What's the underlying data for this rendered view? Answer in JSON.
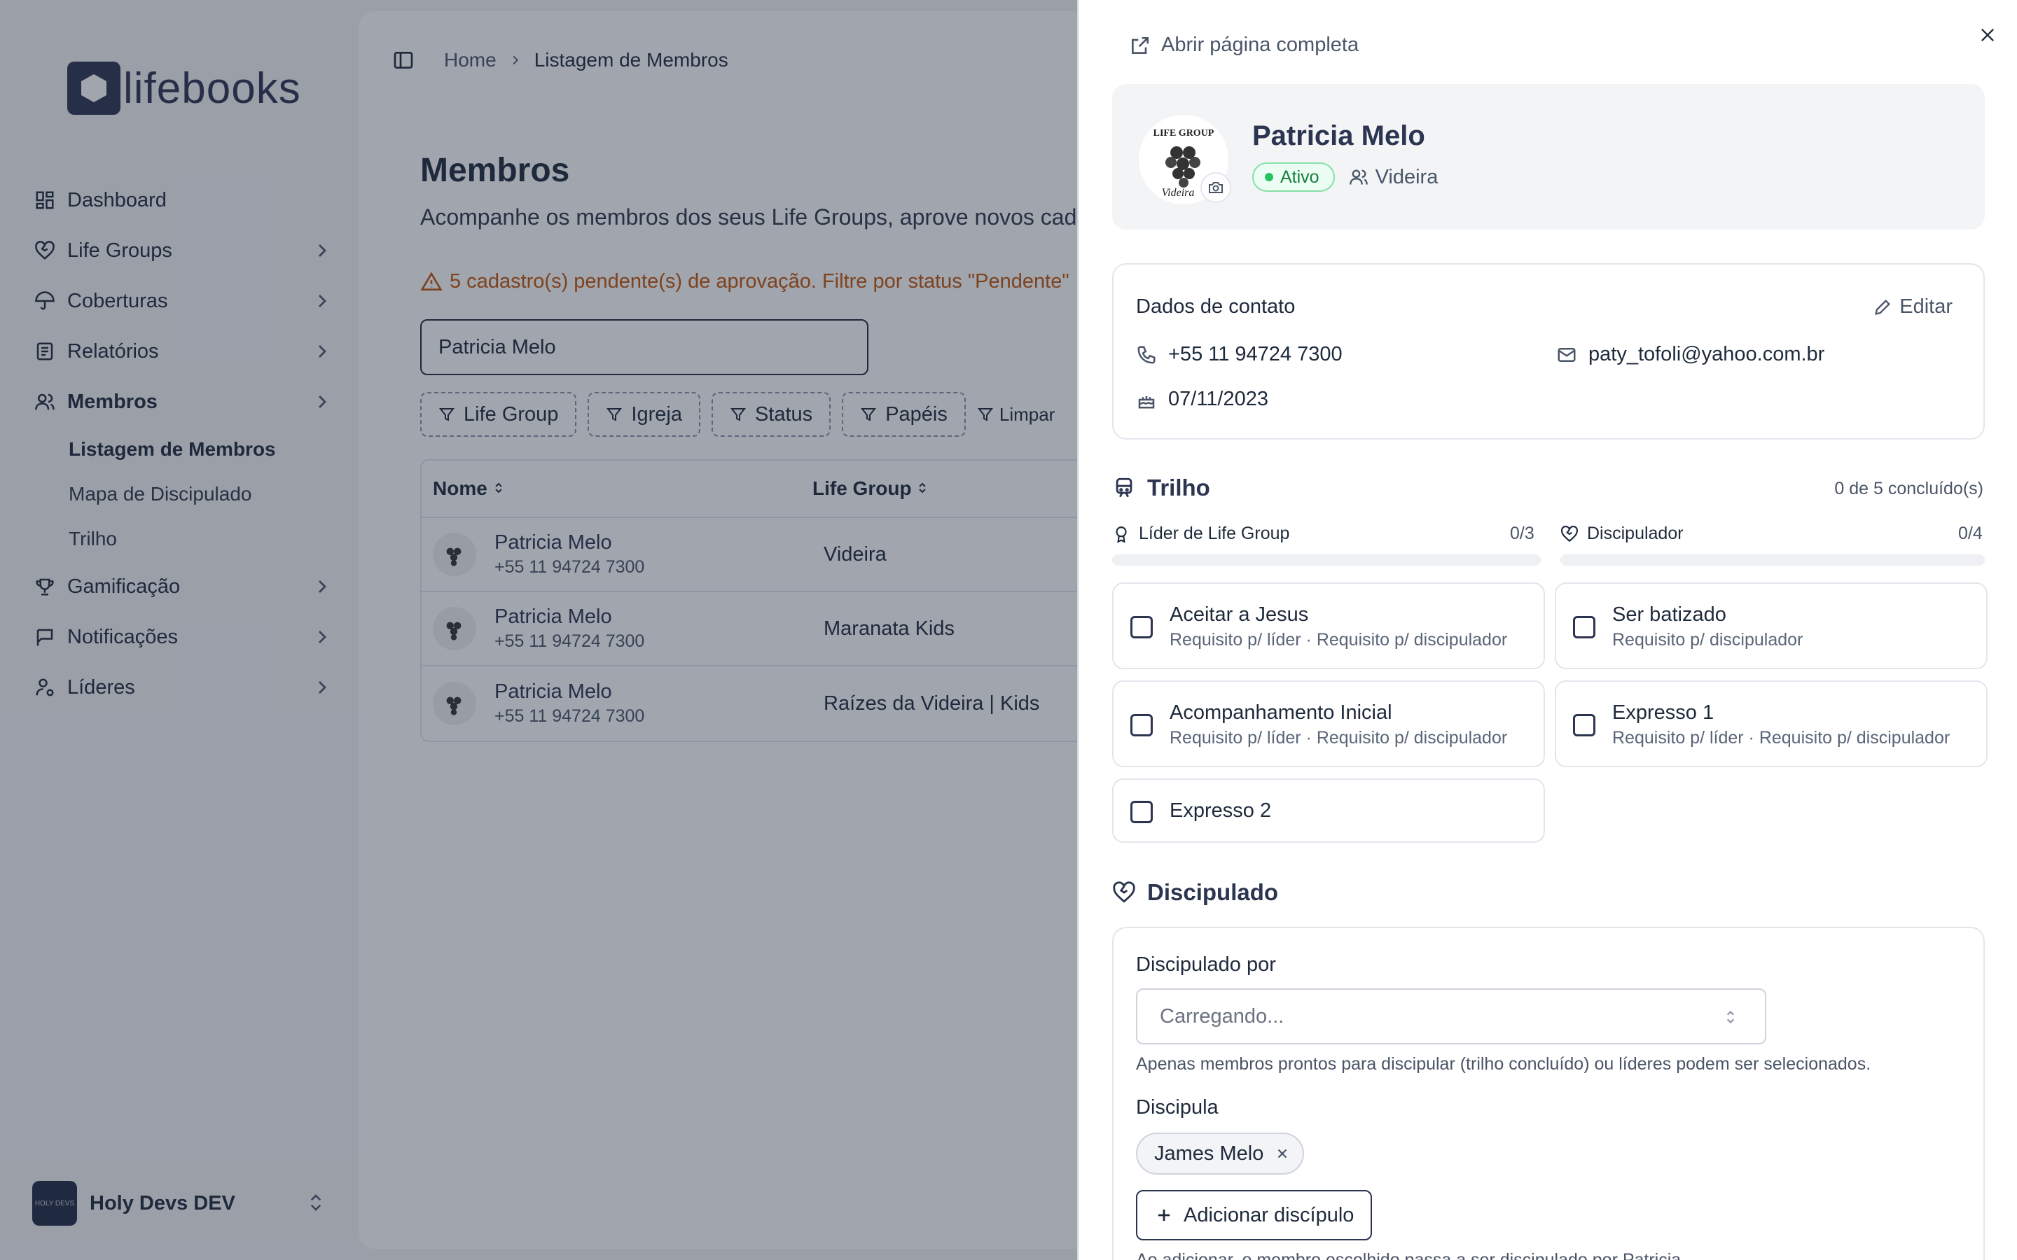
{
  "brand": {
    "name": "lifebooks"
  },
  "sidebar": {
    "items": [
      {
        "label": "Dashboard"
      },
      {
        "label": "Life Groups"
      },
      {
        "label": "Coberturas"
      },
      {
        "label": "Relatórios"
      },
      {
        "label": "Membros"
      },
      {
        "label": "Gamificação"
      },
      {
        "label": "Notificações"
      },
      {
        "label": "Líderes"
      }
    ],
    "sub_items": [
      {
        "label": "Listagem de Membros"
      },
      {
        "label": "Mapa de Discipulado"
      },
      {
        "label": "Trilho"
      }
    ],
    "org": {
      "name": "Holy Devs DEV",
      "avatar_text": "HOLY DEVS"
    }
  },
  "breadcrumb": {
    "home": "Home",
    "current": "Listagem de Membros"
  },
  "page": {
    "title": "Membros",
    "subtitle": "Acompanhe os membros dos seus Life Groups, aprove novos cad",
    "warning": "5 cadastro(s) pendente(s) de aprovação. Filtre por status \"Pendente\"",
    "search_value": "Patricia Melo",
    "filters": [
      "Life Group",
      "Igreja",
      "Status",
      "Papéis"
    ],
    "clear_label": "Limpar"
  },
  "table": {
    "headers": {
      "name": "Nome",
      "life_group": "Life Group"
    },
    "rows": [
      {
        "name": "Patricia Melo",
        "phone": "+55 11 94724 7300",
        "life_group": "Videira"
      },
      {
        "name": "Patricia Melo",
        "phone": "+55 11 94724 7300",
        "life_group": "Maranata Kids"
      },
      {
        "name": "Patricia Melo",
        "phone": "+55 11 94724 7300",
        "life_group": "Raízes da Videira | Kids"
      }
    ]
  },
  "drawer": {
    "open_full": "Abrir página completa",
    "profile": {
      "name": "Patricia Melo",
      "status": "Ativo",
      "group": "Videira",
      "avatar_top_text": "LIFE GROUP",
      "avatar_bottom_text": "Videira"
    },
    "contact": {
      "title": "Dados de contato",
      "edit_label": "Editar",
      "phone": "+55 11 94724 7300",
      "email": "paty_tofoli@yahoo.com.br",
      "birthday": "07/11/2023"
    },
    "track": {
      "title": "Trilho",
      "summary": "0 de 5 concluído(s)",
      "progress": [
        {
          "label": "Líder de Life Group",
          "value_text": "0/3",
          "done": 0,
          "total": 3
        },
        {
          "label": "Discipulador",
          "value_text": "0/4",
          "done": 0,
          "total": 4
        }
      ],
      "steps": [
        {
          "title": "Aceitar a Jesus",
          "subtitle": "Requisito p/ líder · Requisito p/ discipulador"
        },
        {
          "title": "Ser batizado",
          "subtitle": "Requisito p/ discipulador"
        },
        {
          "title": "Acompanhamento Inicial",
          "subtitle": "Requisito p/ líder · Requisito p/ discipulador"
        },
        {
          "title": "Expresso 1",
          "subtitle": "Requisito p/ líder · Requisito p/ discipulador"
        },
        {
          "title": "Expresso 2",
          "subtitle": ""
        }
      ]
    },
    "discipleship": {
      "title": "Discipulado",
      "discipled_by_label": "Discipulado por",
      "select_placeholder": "Carregando...",
      "hint": "Apenas membros prontos para discipular (trilho concluído) ou líderes podem ser selecionados.",
      "disciples_label": "Discipula",
      "chip": "James Melo",
      "add_label": "Adicionar discípulo",
      "note": "Ao adicionar, o membro escolhido passa a ser discipulado por Patricia."
    }
  },
  "colors": {
    "accent": "#2b3550",
    "warning": "#c2570c",
    "success": "#15803d"
  }
}
